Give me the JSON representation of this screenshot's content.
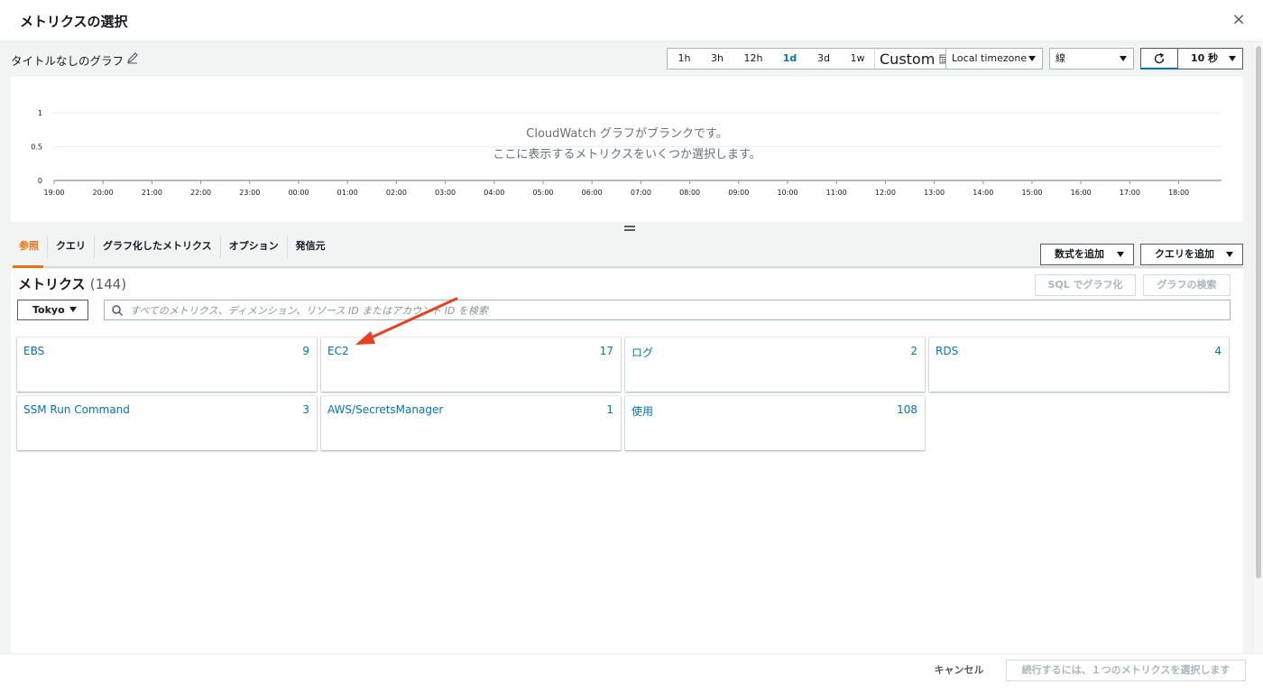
{
  "modal": {
    "title": "メトリクスの選択",
    "close_label": "×"
  },
  "graph": {
    "title": "タイトルなしのグラフ",
    "empty_line1": "CloudWatch グラフがブランクです。",
    "empty_line2": "ここに表示するメトリクスをいくつか選択します。"
  },
  "time_ranges": [
    "1h",
    "3h",
    "12h",
    "1d",
    "3d",
    "1w"
  ],
  "active_time_range": "1d",
  "custom_label": "Custom",
  "timezone_select": "Local timezone",
  "chart_type_select": "線",
  "refresh_interval": "10 秒",
  "chart_data": {
    "type": "line",
    "x_ticks": [
      "19:00",
      "20:00",
      "21:00",
      "22:00",
      "23:00",
      "00:00",
      "01:00",
      "02:00",
      "03:00",
      "04:00",
      "05:00",
      "06:00",
      "07:00",
      "08:00",
      "09:00",
      "10:00",
      "11:00",
      "12:00",
      "13:00",
      "14:00",
      "15:00",
      "16:00",
      "17:00",
      "18:00"
    ],
    "y_ticks": [
      "1",
      "0.5",
      "0"
    ],
    "ylim": [
      0,
      1
    ],
    "series": [],
    "grid": true
  },
  "tabs": [
    {
      "label": "参照",
      "active": true
    },
    {
      "label": "クエリ",
      "active": false
    },
    {
      "label": "グラフ化したメトリクス",
      "active": false
    },
    {
      "label": "オプション",
      "active": false
    },
    {
      "label": "発信元",
      "active": false
    }
  ],
  "add_math_label": "数式を追加",
  "add_query_label": "クエリを追加",
  "metrics": {
    "title": "メトリクス",
    "count": "(144)",
    "sql_button": "SQL でグラフ化",
    "graph_search_button": "グラフの検索",
    "region": "Tokyo",
    "search_placeholder": "すべてのメトリクス、ディメンション、リソース ID またはアカウント ID を検索"
  },
  "namespaces": [
    {
      "name": "EBS",
      "count": "9"
    },
    {
      "name": "EC2",
      "count": "17"
    },
    {
      "name": "ログ",
      "count": "2"
    },
    {
      "name": "RDS",
      "count": "4"
    },
    {
      "name": "SSM Run Command",
      "count": "3"
    },
    {
      "name": "AWS/SecretsManager",
      "count": "1"
    },
    {
      "name": "使用",
      "count": "108"
    }
  ],
  "footer": {
    "cancel_label": "キャンセル",
    "continue_label": "続行するには、１つのメトリクスを選択します"
  },
  "colors": {
    "link": "#0073bb",
    "active_tab": "#ec7211",
    "annotation_arrow": "#e8411f"
  }
}
